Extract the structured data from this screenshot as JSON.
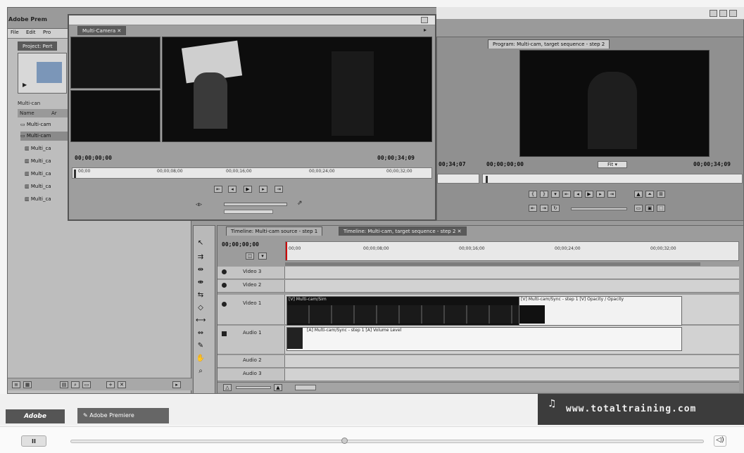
{
  "app": {
    "title": "Adobe Prem",
    "menu": [
      "File",
      "Edit",
      "Pro"
    ]
  },
  "project": {
    "tab_label": "Project: Pert",
    "list_header": [
      "Name",
      "Ar"
    ],
    "items": [
      "Multi-cam",
      "Multi-cam",
      "Multi_ca",
      "Multi_ca",
      "Multi_ca",
      "Multi_ca",
      "Multi_ca"
    ],
    "top_item": "Multi-can"
  },
  "multicam": {
    "tab_label": "Multi-Camera",
    "timecode_in": "00;00;00;00",
    "timecode_out": "00;00;34;09",
    "ruler_ticks": [
      "00;00",
      "00;00;08;00",
      "00;00;16;00",
      "00;00;24;00",
      "00;00;32;00"
    ]
  },
  "program": {
    "tab_label": "Program: Multi-cam, target sequence - step 2",
    "timecode_in": "00;00;00;00",
    "timecode_out": "00;00;34;09",
    "left_timecode": "00;34;07",
    "fit_label": "Fit"
  },
  "timeline": {
    "tabs": [
      "Timeline: Multi-cam source - step 1",
      "Timeline: Multi-cam, target sequence - step 2"
    ],
    "timecode": "00;00;00;00",
    "ruler_ticks": [
      "00;00",
      "00;00;08;00",
      "00;00;16;00",
      "00;00;24;00",
      "00;00;32;00"
    ],
    "tracks": [
      "Video 3",
      "Video 2",
      "Video 1",
      "Audio 1",
      "Audio 2",
      "Audio 3"
    ],
    "clip_label": "[V] Multi-cam/Sim",
    "video_clip_tail": "[V] Multi-cam/Sync - step 1 [V] Opacity / Opacity",
    "audio_clip_tail": "[A] Multi-cam/Sync - step 1 [A] Volume Level"
  },
  "player": {
    "watermark": "www.totaltraining.com",
    "left_button": "Adobe",
    "taskbar_item": "Adobe Premiere",
    "play_button": "II"
  }
}
